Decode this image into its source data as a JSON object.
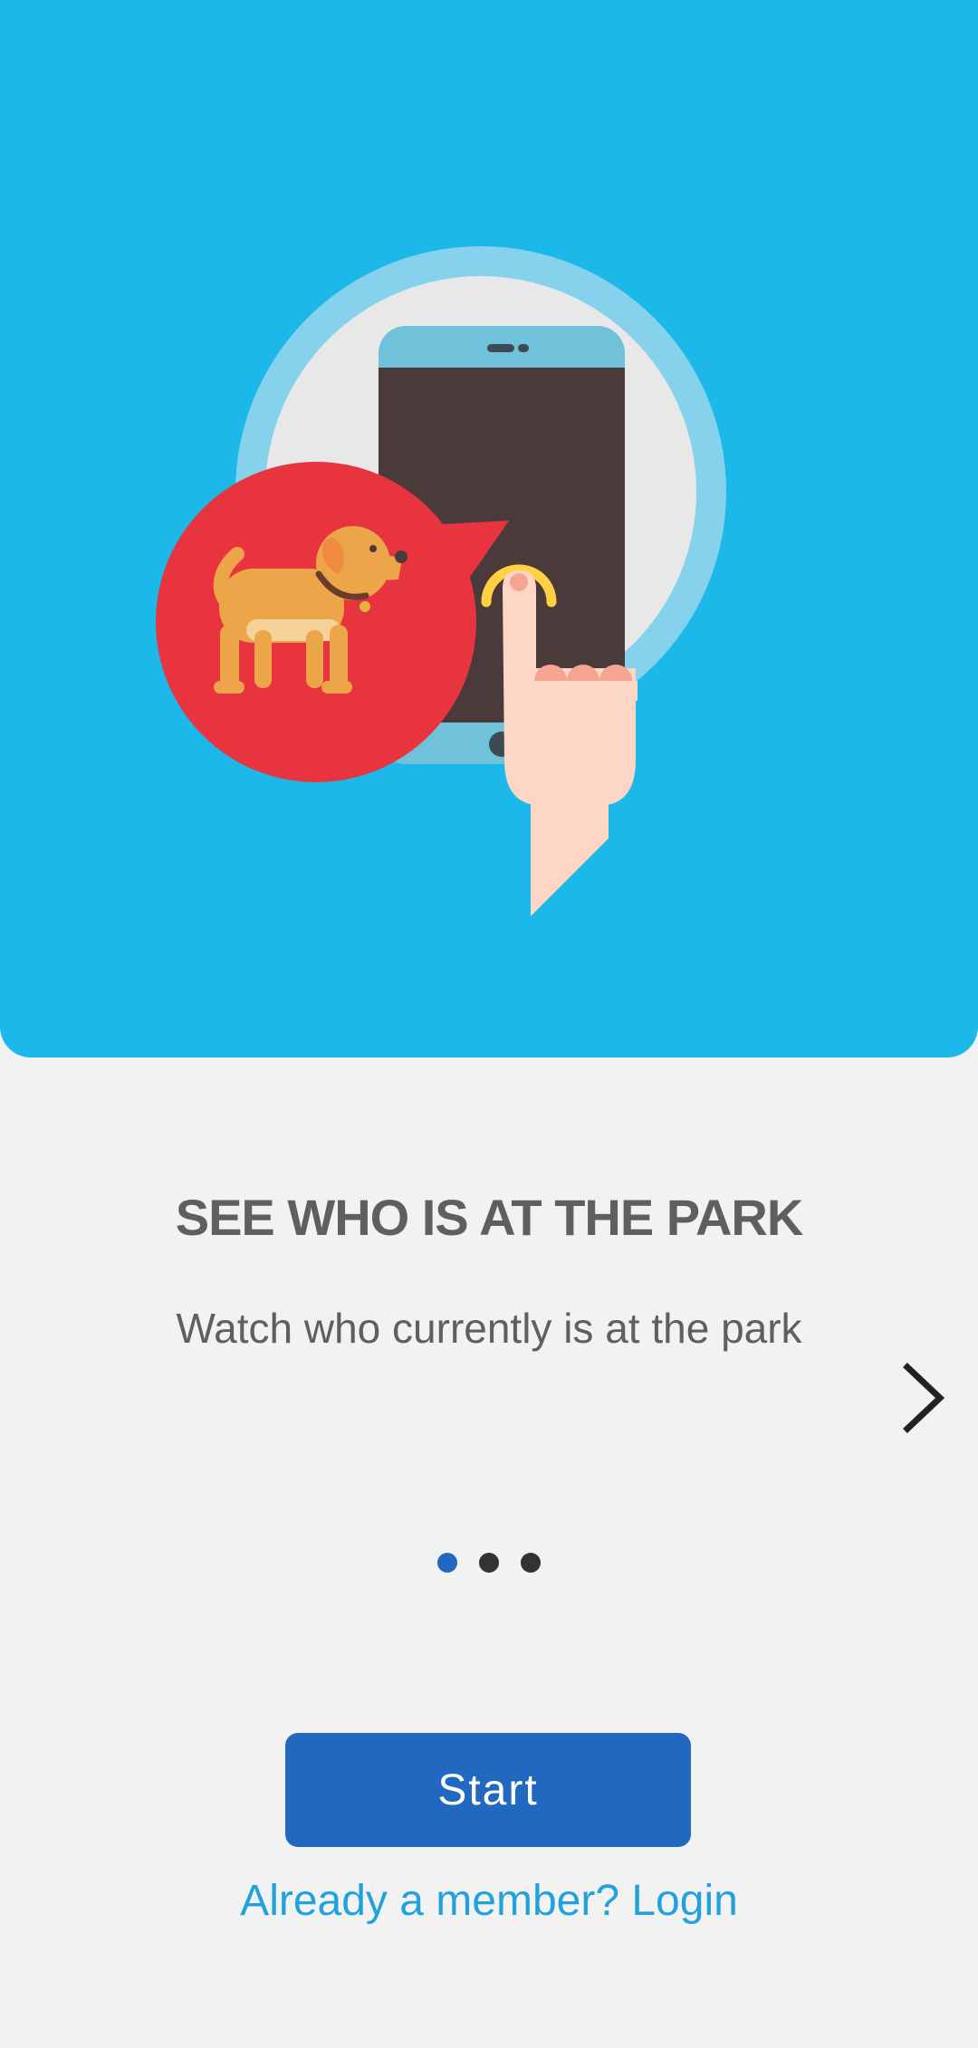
{
  "onboarding": {
    "title": "SEE WHO IS AT THE PARK",
    "subtitle": "Watch who currently is at the park",
    "next_icon": "chevron-right-icon",
    "current_page": 1,
    "total_pages": 3,
    "hero_illustration": "phone-tap-dog-illustration"
  },
  "actions": {
    "start_label": "Start",
    "login_label": "Already a member? Login"
  },
  "colors": {
    "hero_background": "#1cb8ea",
    "page_background": "#f2f2f2",
    "primary": "#2168c0",
    "link": "#22a2dd",
    "text": "#5f5f5f",
    "dog_bubble": "#e8343f"
  }
}
